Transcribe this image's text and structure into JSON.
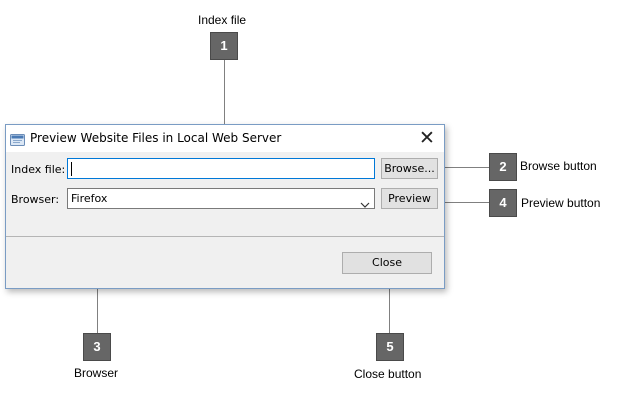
{
  "window": {
    "title": "Preview Website Files in Local Web Server",
    "close_glyph": "✕"
  },
  "form": {
    "index_file_label": "Index file:",
    "index_file_value": "",
    "browse_button": "Browse...",
    "browser_label": "Browser:",
    "browser_selected": "Firefox",
    "preview_button": "Preview"
  },
  "footer": {
    "close_button": "Close"
  },
  "annotations": [
    {
      "number": "1",
      "label": "Index file"
    },
    {
      "number": "2",
      "label": "Browse button"
    },
    {
      "number": "3",
      "label": "Browser"
    },
    {
      "number": "4",
      "label": "Preview button"
    },
    {
      "number": "5",
      "label": "Close button"
    }
  ],
  "colors": {
    "badge": "#666666",
    "focus_border": "#0078d7",
    "window_border": "#7a9cc4",
    "dialog_bg": "#f0f0f0"
  },
  "icons": [
    "window-app-icon",
    "close-icon",
    "chevron-down-icon"
  ]
}
